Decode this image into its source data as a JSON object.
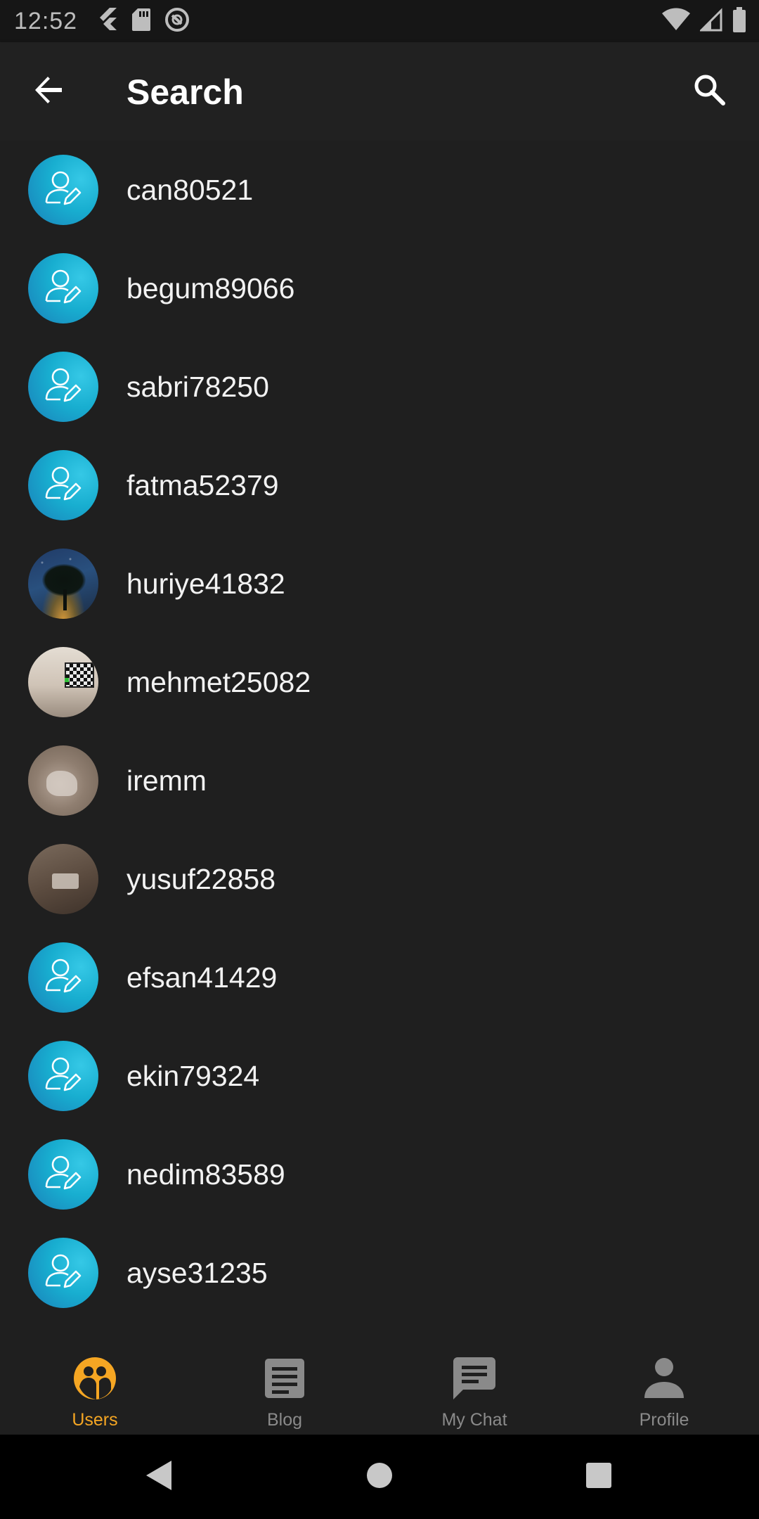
{
  "status_bar": {
    "time": "12:52",
    "left_icons": [
      "flutter-icon",
      "sd-card-icon",
      "do-not-disturb-icon"
    ],
    "right_icons": [
      "wifi-icon",
      "cell-signal-icon",
      "battery-icon"
    ]
  },
  "app_bar": {
    "title": "Search",
    "back_icon": "arrow-back-icon",
    "search_icon": "search-icon"
  },
  "users": [
    {
      "name": "can80521",
      "avatar": "default"
    },
    {
      "name": "begum89066",
      "avatar": "default"
    },
    {
      "name": "sabri78250",
      "avatar": "default"
    },
    {
      "name": "fatma52379",
      "avatar": "default"
    },
    {
      "name": "huriye41832",
      "avatar": "photo-night-tree"
    },
    {
      "name": "mehmet25082",
      "avatar": "photo-room"
    },
    {
      "name": "iremm",
      "avatar": "photo-dog"
    },
    {
      "name": "yusuf22858",
      "avatar": "photo-table"
    },
    {
      "name": "efsan41429",
      "avatar": "default"
    },
    {
      "name": "ekin79324",
      "avatar": "default"
    },
    {
      "name": "nedim83589",
      "avatar": "default"
    },
    {
      "name": "ayse31235",
      "avatar": "default"
    }
  ],
  "bottom_nav": {
    "items": [
      {
        "label": "Users",
        "icon": "users-icon",
        "active": true
      },
      {
        "label": "Blog",
        "icon": "article-icon",
        "active": false
      },
      {
        "label": "My Chat",
        "icon": "chat-icon",
        "active": false
      },
      {
        "label": "Profile",
        "icon": "person-icon",
        "active": false
      }
    ]
  },
  "colors": {
    "background": "#1f1f1f",
    "app_bar": "#212121",
    "accent": "#f5a623",
    "inactive": "#8a8a8a",
    "avatar_blue": "#18aed0"
  }
}
